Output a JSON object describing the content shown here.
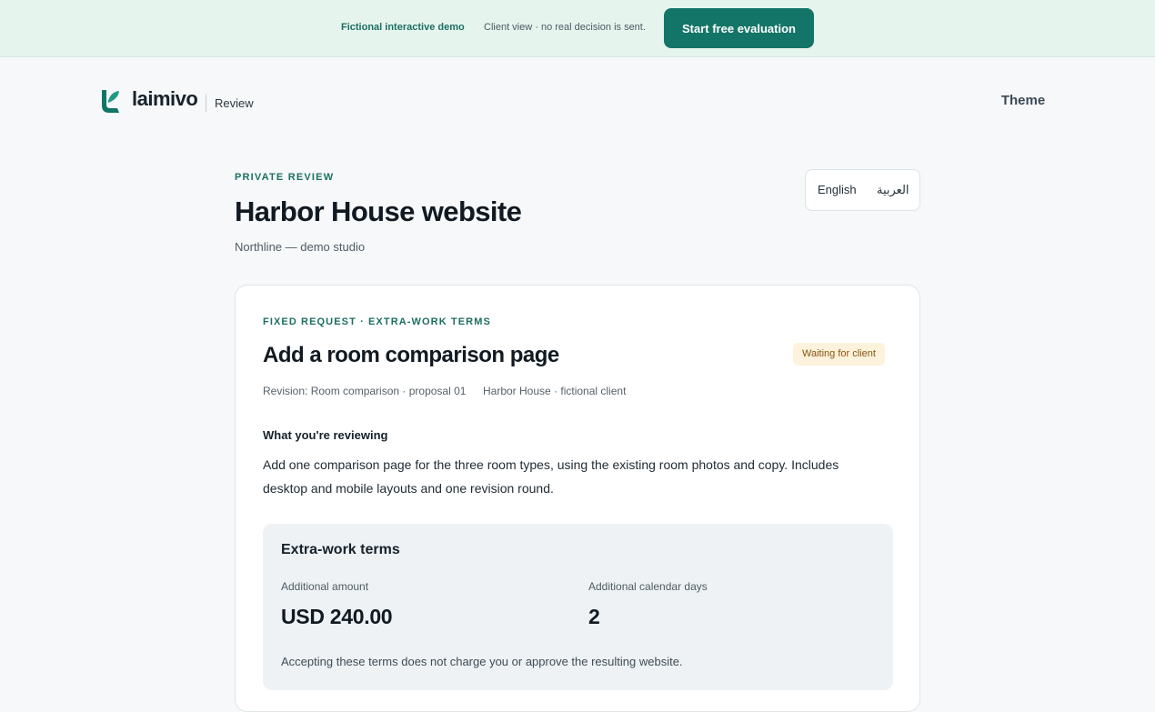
{
  "banner": {
    "demo_label": "Fictional interactive demo",
    "note": "Client view · no real decision is sent.",
    "cta_label": "Start free evaluation"
  },
  "header": {
    "brand": "laimivo",
    "product": "Review",
    "theme_label": "Theme"
  },
  "page": {
    "eyebrow": "PRIVATE REVIEW",
    "title": "Harbor House website",
    "studio": "Northline — demo studio"
  },
  "language": {
    "options": [
      "English",
      "العربية"
    ]
  },
  "request": {
    "eyebrow": "FIXED REQUEST · EXTRA-WORK TERMS",
    "title": "Add a room comparison page",
    "status": "Waiting for client",
    "revision": "Revision: Room comparison · proposal 01",
    "client": "Harbor House · fictional client",
    "review_heading": "What you're reviewing",
    "review_text": "Add one comparison page for the three room types, using the existing room photos and copy. Includes desktop and mobile layouts and one revision round."
  },
  "terms": {
    "title": "Extra-work terms",
    "amount_label": "Additional amount",
    "amount_value": "USD 240.00",
    "days_label": "Additional calendar days",
    "days_value": "2",
    "note": "Accepting these terms does not charge you or approve the resulting website."
  },
  "colors": {
    "accent": "#137567",
    "banner_bg": "#e6f4ee",
    "status_bg": "#fdf2dc",
    "status_text": "#8a5411"
  }
}
